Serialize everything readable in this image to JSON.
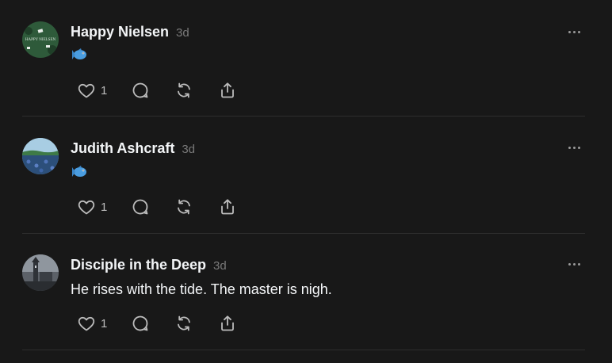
{
  "posts": [
    {
      "username": "Happy Nielsen",
      "time": "3d",
      "text": "",
      "content_emoji": "fish",
      "avatar_text": "HAPPY NIELSEN",
      "likes": "1"
    },
    {
      "username": "Judith Ashcraft",
      "time": "3d",
      "text": "",
      "content_emoji": "fish",
      "likes": "1"
    },
    {
      "username": "Disciple in the Deep",
      "time": "3d",
      "text": "He rises with the tide. The master is nigh.",
      "likes": "1"
    }
  ],
  "icons": {
    "like": "heart-icon",
    "reply": "speech-bubble-icon",
    "repost": "repost-icon",
    "share": "share-icon",
    "more": "more-options-icon"
  },
  "colors": {
    "background": "#181818",
    "text": "#f3f5f7",
    "muted": "#7a7a7a",
    "divider": "#2d2d2d",
    "icon": "#bcbcbc"
  }
}
